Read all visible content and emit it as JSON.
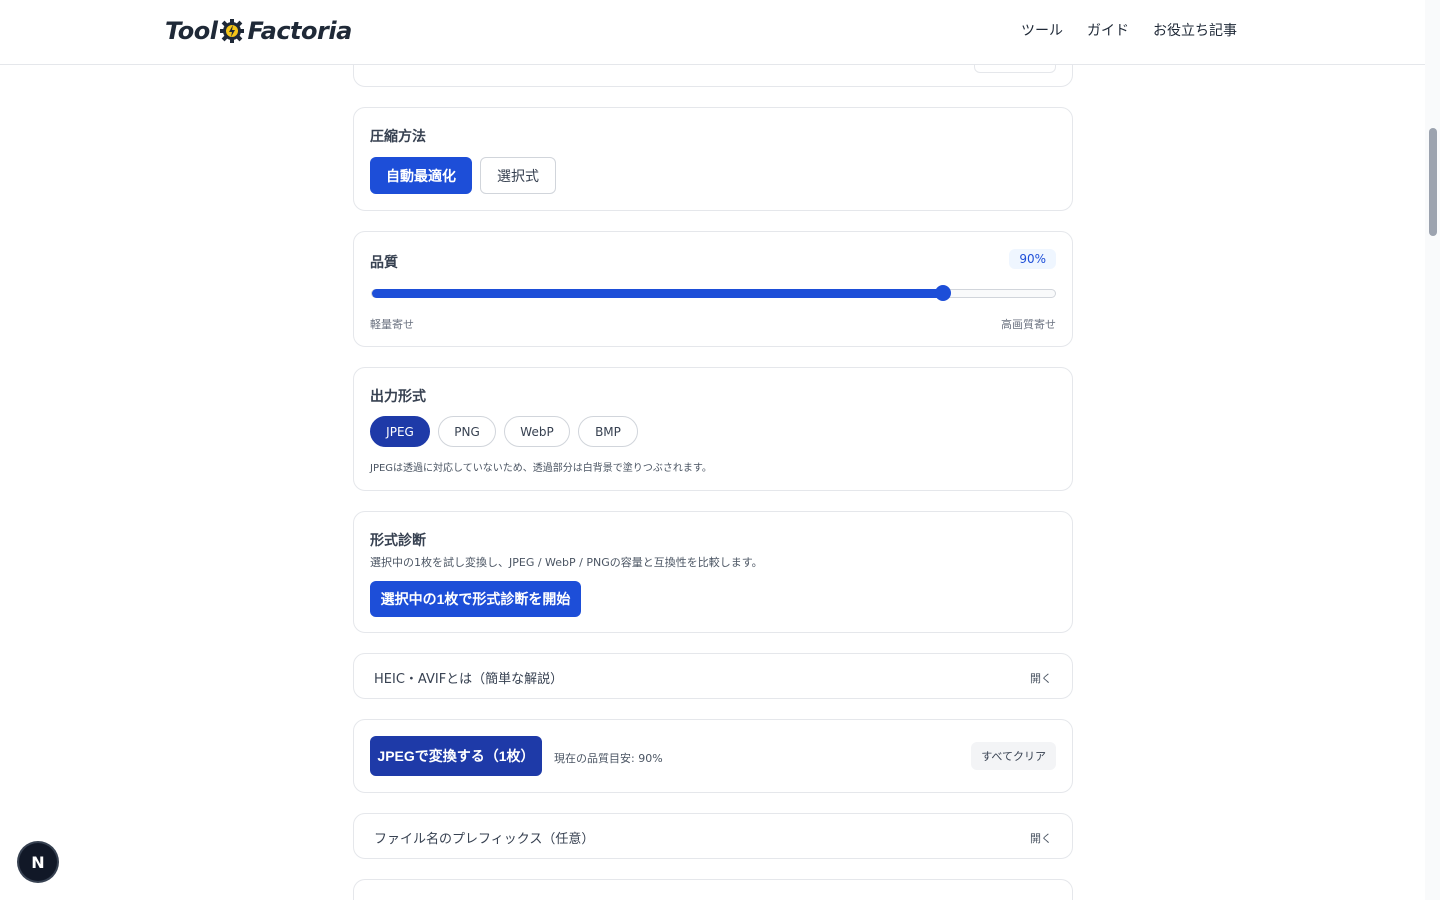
{
  "header": {
    "logo_left": "Tool",
    "logo_right": "Factoria",
    "nav": [
      "ツール",
      "ガイド",
      "お役立ち記事"
    ]
  },
  "compression": {
    "title": "圧縮方法",
    "options": [
      "自動最適化",
      "選択式"
    ],
    "selected": "自動最適化"
  },
  "quality": {
    "title": "品質",
    "value_label": "90%",
    "value": 90,
    "min_label": "軽量寄せ",
    "max_label": "高画質寄せ"
  },
  "output_format": {
    "title": "出力形式",
    "options": [
      "JPEG",
      "PNG",
      "WebP",
      "BMP"
    ],
    "selected": "JPEG",
    "note": "JPEGは透過に対応していないため、透過部分は白背景で塗りつぶされます。"
  },
  "diagnosis": {
    "title": "形式診断",
    "description": "選択中の1枚を試し変換し、JPEG / WebP / PNGの容量と互換性を比較します。",
    "button": "選択中の1枚で形式診断を開始"
  },
  "heic_info": {
    "title": "HEIC・AVIFとは（簡単な解説）",
    "toggle": "開く"
  },
  "convert": {
    "button": "JPEGで変換する（1枚）",
    "status": "現在の品質目安: 90%",
    "clear": "すべてクリア"
  },
  "prefix": {
    "title": "ファイル名のプレフィックス（任意）",
    "toggle": "開く"
  },
  "fab": {
    "label": "N"
  },
  "colors": {
    "primary": "#1d4ed8",
    "primary_dark": "#1e3aa8",
    "border": "#e5e7eb"
  }
}
